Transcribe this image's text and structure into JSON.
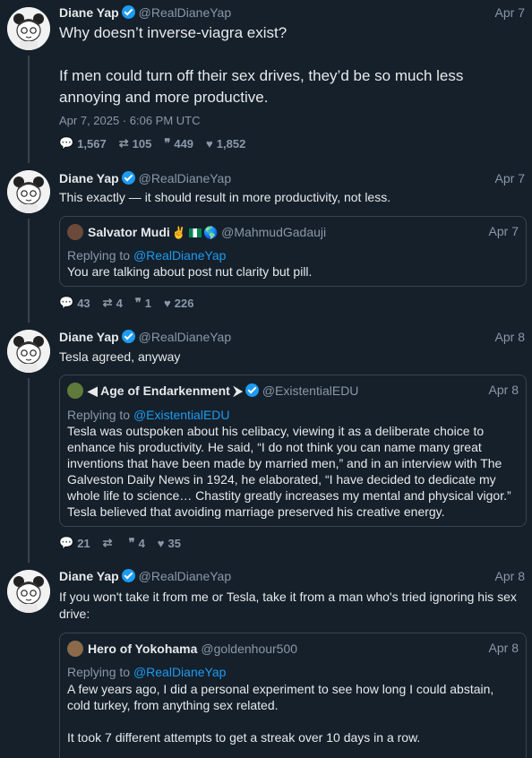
{
  "tweets": [
    {
      "author": "Diane Yap",
      "handle": "@RealDianeYap",
      "date": "Apr 7",
      "text": "Why doesn’t inverse-viagra exist?\n\nIf men could turn off their sex drives, they’d be so much less annoying and more productive.",
      "timestamp": "Apr 7, 2025 · 6:06 PM UTC",
      "stats": {
        "replies": "1,567",
        "retweets": "105",
        "quotes": "449",
        "likes": "1,852"
      }
    },
    {
      "author": "Diane Yap",
      "handle": "@RealDianeYap",
      "date": "Apr 7",
      "text": "This exactly — it should result in more productivity, not less.",
      "quote": {
        "author": "Salvator Mudi",
        "handle": "@MahmudGadauji",
        "date": "Apr 7",
        "replying_label": "Replying to",
        "replying_to": "@RealDianeYap",
        "text": "You are talking about post nut clarity but pill."
      },
      "stats": {
        "replies": "43",
        "retweets": "4",
        "quotes": "1",
        "likes": "226"
      }
    },
    {
      "author": "Diane Yap",
      "handle": "@RealDianeYap",
      "date": "Apr 8",
      "text": "Tesla agreed, anyway",
      "quote": {
        "author": "◀ Age of Endarkenment ⮞",
        "handle": "@ExistentialEDU",
        "date": "Apr 8",
        "replying_label": "Replying to",
        "replying_to": "@ExistentialEDU",
        "text": "Tesla was outspoken about his celibacy, viewing it as a deliberate choice to enhance his productivity. He said, “I do not think you can name many great inventions that have been made by married men,” and in an interview with The Galveston Daily News in 1924, he elaborated, “I have decided to dedicate my whole life to science… Chastity greatly increases my mental and physical vigor.” Tesla believed that avoiding marriage preserved his creative energy."
      },
      "stats": {
        "replies": "21",
        "retweets": "",
        "quotes": "4",
        "likes": "35"
      }
    },
    {
      "author": "Diane Yap",
      "handle": "@RealDianeYap",
      "date": "Apr 8",
      "text": "If you won't take it from me or Tesla, take it from a man who's tried ignoring his sex drive:",
      "quote": {
        "author": "Hero of Yokohama",
        "handle": "@goldenhour500",
        "date": "Apr 8",
        "replying_label": "Replying to",
        "replying_to": "@RealDianeYap",
        "text": "A few years ago, I did a personal experiment to see how long I could abstain, cold turkey, from anything sex related.\n\nIt took 7 different attempts to get a streak over 10 days in a row."
      }
    }
  ],
  "icons": {
    "reply": "comment-icon",
    "retweet": "retweet-icon",
    "quote": "quote-icon",
    "like": "heart-icon"
  },
  "colors": {
    "background": "#15202b",
    "accent": "#1d9bf0",
    "muted": "#8b98a5",
    "border": "#38444d"
  }
}
